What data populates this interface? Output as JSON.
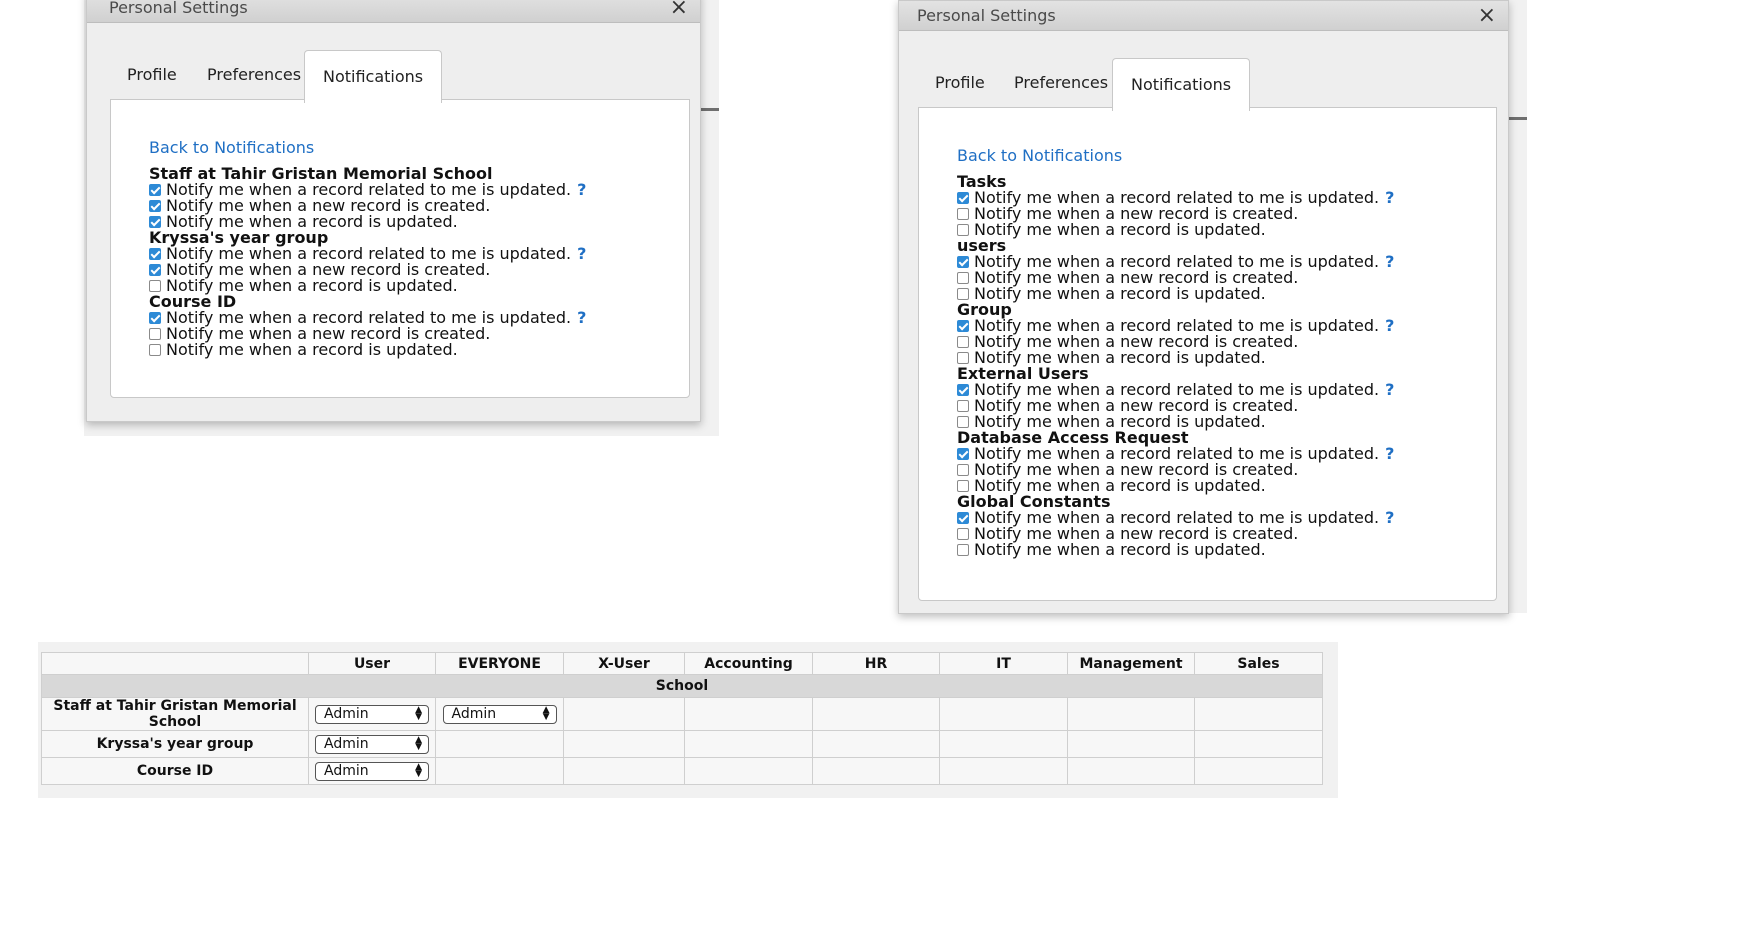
{
  "dialog_left": {
    "title": "Personal Settings",
    "close_label": "×",
    "tabs": [
      {
        "label": "Profile"
      },
      {
        "label": "Preferences"
      },
      {
        "label": "Notifications"
      }
    ],
    "back_link": "Back to Notifications",
    "groups": [
      {
        "name": "Staff at Tahir Gristan Memorial School",
        "options": [
          {
            "label": "Notify me when a record related to me is updated.",
            "checked": true,
            "help": "?"
          },
          {
            "label": "Notify me when a new record is created.",
            "checked": true
          },
          {
            "label": "Notify me when a record is updated.",
            "checked": true
          }
        ]
      },
      {
        "name": "Kryssa's year group",
        "options": [
          {
            "label": "Notify me when a record related to me is updated.",
            "checked": true,
            "help": "?"
          },
          {
            "label": "Notify me when a new record is created.",
            "checked": true
          },
          {
            "label": "Notify me when a record is updated.",
            "checked": false
          }
        ]
      },
      {
        "name": "Course ID",
        "options": [
          {
            "label": "Notify me when a record related to me is updated.",
            "checked": true,
            "help": "?"
          },
          {
            "label": "Notify me when a new record is created.",
            "checked": false
          },
          {
            "label": "Notify me when a record is updated.",
            "checked": false
          }
        ]
      }
    ]
  },
  "dialog_right": {
    "title": "Personal Settings",
    "close_label": "×",
    "tabs": [
      {
        "label": "Profile"
      },
      {
        "label": "Preferences"
      },
      {
        "label": "Notifications"
      }
    ],
    "back_link": "Back to Notifications",
    "groups": [
      {
        "name": "Tasks",
        "options": [
          {
            "label": "Notify me when a record related to me is updated.",
            "checked": true,
            "help": "?"
          },
          {
            "label": "Notify me when a new record is created.",
            "checked": false
          },
          {
            "label": "Notify me when a record is updated.",
            "checked": false
          }
        ]
      },
      {
        "name": "users",
        "options": [
          {
            "label": "Notify me when a record related to me is updated.",
            "checked": true,
            "help": "?"
          },
          {
            "label": "Notify me when a new record is created.",
            "checked": false
          },
          {
            "label": "Notify me when a record is updated.",
            "checked": false
          }
        ]
      },
      {
        "name": "Group",
        "options": [
          {
            "label": "Notify me when a record related to me is updated.",
            "checked": true,
            "help": "?"
          },
          {
            "label": "Notify me when a new record is created.",
            "checked": false
          },
          {
            "label": "Notify me when a record is updated.",
            "checked": false
          }
        ]
      },
      {
        "name": "External Users",
        "options": [
          {
            "label": "Notify me when a record related to me is updated.",
            "checked": true,
            "help": "?"
          },
          {
            "label": "Notify me when a new record is created.",
            "checked": false
          },
          {
            "label": "Notify me when a record is updated.",
            "checked": false
          }
        ]
      },
      {
        "name": "Database Access Request",
        "options": [
          {
            "label": "Notify me when a record related to me is updated.",
            "checked": true,
            "help": "?"
          },
          {
            "label": "Notify me when a new record is created.",
            "checked": false
          },
          {
            "label": "Notify me when a record is updated.",
            "checked": false
          }
        ]
      },
      {
        "name": "Global Constants",
        "options": [
          {
            "label": "Notify me when a record related to me is updated.",
            "checked": true,
            "help": "?"
          },
          {
            "label": "Notify me when a new record is created.",
            "checked": false
          },
          {
            "label": "Notify me when a record is updated.",
            "checked": false
          }
        ]
      }
    ]
  },
  "permissions_table": {
    "columns": [
      "",
      "User",
      "EVERYONE",
      "X-User",
      "Accounting",
      "HR",
      "IT",
      "Management",
      "Sales"
    ],
    "section": "School",
    "rows": [
      {
        "label": "Staff at Tahir Gristan Memorial School",
        "cells": [
          "Admin",
          "Admin",
          "",
          "",
          "",
          "",
          "",
          ""
        ]
      },
      {
        "label": "Kryssa's year group",
        "cells": [
          "Admin",
          "",
          "",
          "",
          "",
          "",
          "",
          ""
        ]
      },
      {
        "label": "Course ID",
        "cells": [
          "Admin",
          "",
          "",
          "",
          "",
          "",
          "",
          ""
        ]
      }
    ]
  },
  "colors": {
    "link": "#1f6fc4",
    "checkbox_checked": "#2d8ad6"
  }
}
